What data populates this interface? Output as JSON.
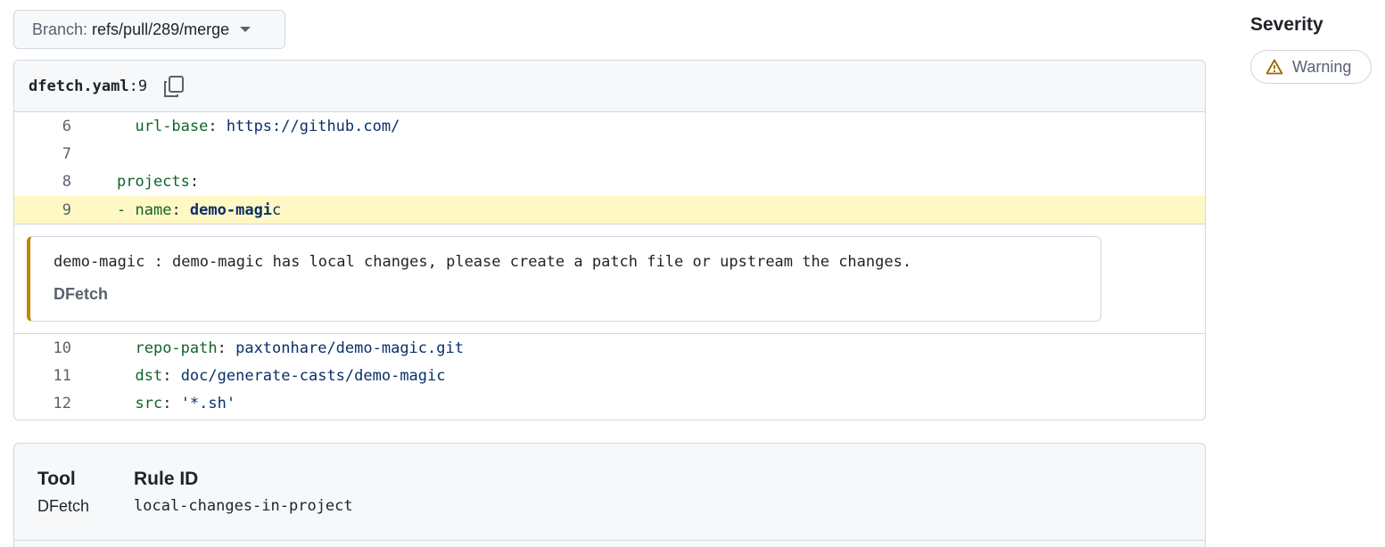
{
  "branch": {
    "label": "Branch:",
    "value": "refs/pull/289/merge"
  },
  "file": {
    "name": "dfetch.yaml",
    "line": ":9"
  },
  "code_lines_top": [
    {
      "num": "6",
      "parts": [
        {
          "t": "  "
        },
        {
          "t": "url-base",
          "c": "key"
        },
        {
          "t": ": "
        },
        {
          "t": "https://github.com/",
          "c": "val"
        }
      ]
    },
    {
      "num": "7",
      "parts": []
    },
    {
      "num": "8",
      "parts": [
        {
          "t": "projects",
          "c": "key"
        },
        {
          "t": ":"
        }
      ]
    },
    {
      "num": "9",
      "hl": true,
      "parts": [
        {
          "t": "- ",
          "c": "key"
        },
        {
          "t": "name",
          "c": "key"
        },
        {
          "t": ": "
        },
        {
          "t": "demo-magi",
          "c": "bold"
        },
        {
          "t": "c",
          "c": "val"
        }
      ]
    }
  ],
  "alert": {
    "message": "demo-magic : demo-magic has local changes, please create a patch file or upstream the changes.",
    "tool": "DFetch"
  },
  "code_lines_bottom": [
    {
      "num": "10",
      "parts": [
        {
          "t": "  "
        },
        {
          "t": "repo-path",
          "c": "key"
        },
        {
          "t": ": "
        },
        {
          "t": "paxtonhare/demo-magic.git",
          "c": "val"
        }
      ]
    },
    {
      "num": "11",
      "parts": [
        {
          "t": "  "
        },
        {
          "t": "dst",
          "c": "key"
        },
        {
          "t": ": "
        },
        {
          "t": "doc/generate-casts/demo-magic",
          "c": "val"
        }
      ]
    },
    {
      "num": "12",
      "parts": [
        {
          "t": "  "
        },
        {
          "t": "src",
          "c": "key"
        },
        {
          "t": ": "
        },
        {
          "t": "'*.sh'",
          "c": "val"
        }
      ]
    }
  ],
  "severity": {
    "title": "Severity",
    "badge": "Warning",
    "icon": "alert-triangle-icon",
    "color": "#9a6700"
  },
  "rule": {
    "tool_header": "Tool",
    "tool_value": "DFetch",
    "rule_header": "Rule ID",
    "rule_value": "local-changes-in-project"
  }
}
